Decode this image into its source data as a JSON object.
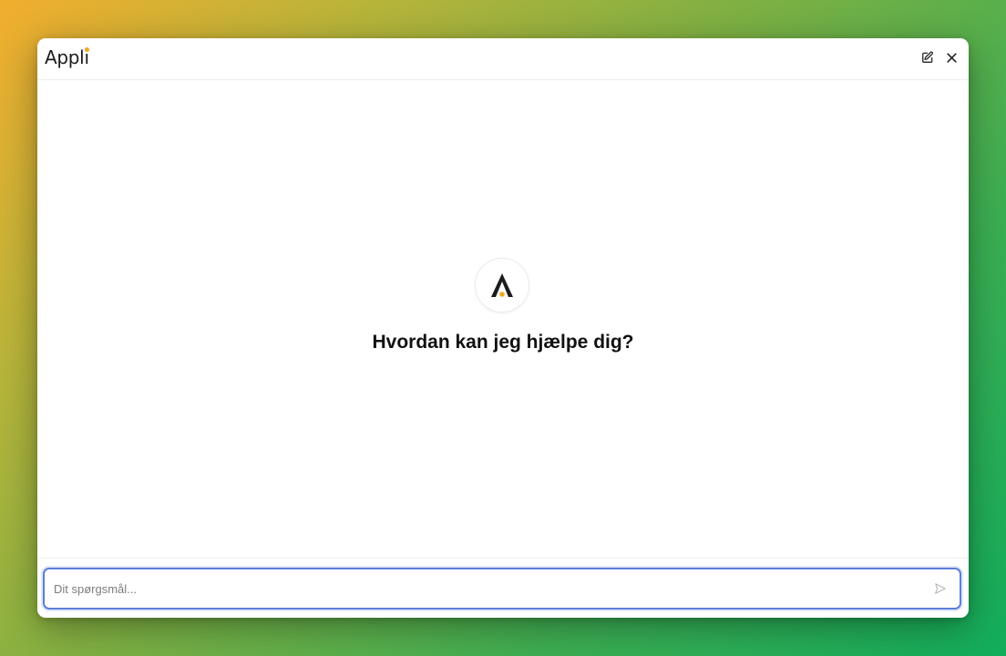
{
  "header": {
    "logo_text_main": "Appl",
    "logo_text_i": "ı",
    "edit_icon": "edit-icon",
    "close_icon": "close-icon"
  },
  "main": {
    "avatar_icon": "applai-a-icon",
    "greeting": "Hvordan kan jeg hjælpe dig?"
  },
  "composer": {
    "placeholder": "Dit spørgsmål...",
    "value": "",
    "send_icon": "send-icon"
  },
  "colors": {
    "accent": "#f2a81d",
    "focus_border": "#5b7fd8",
    "text": "#111111"
  }
}
